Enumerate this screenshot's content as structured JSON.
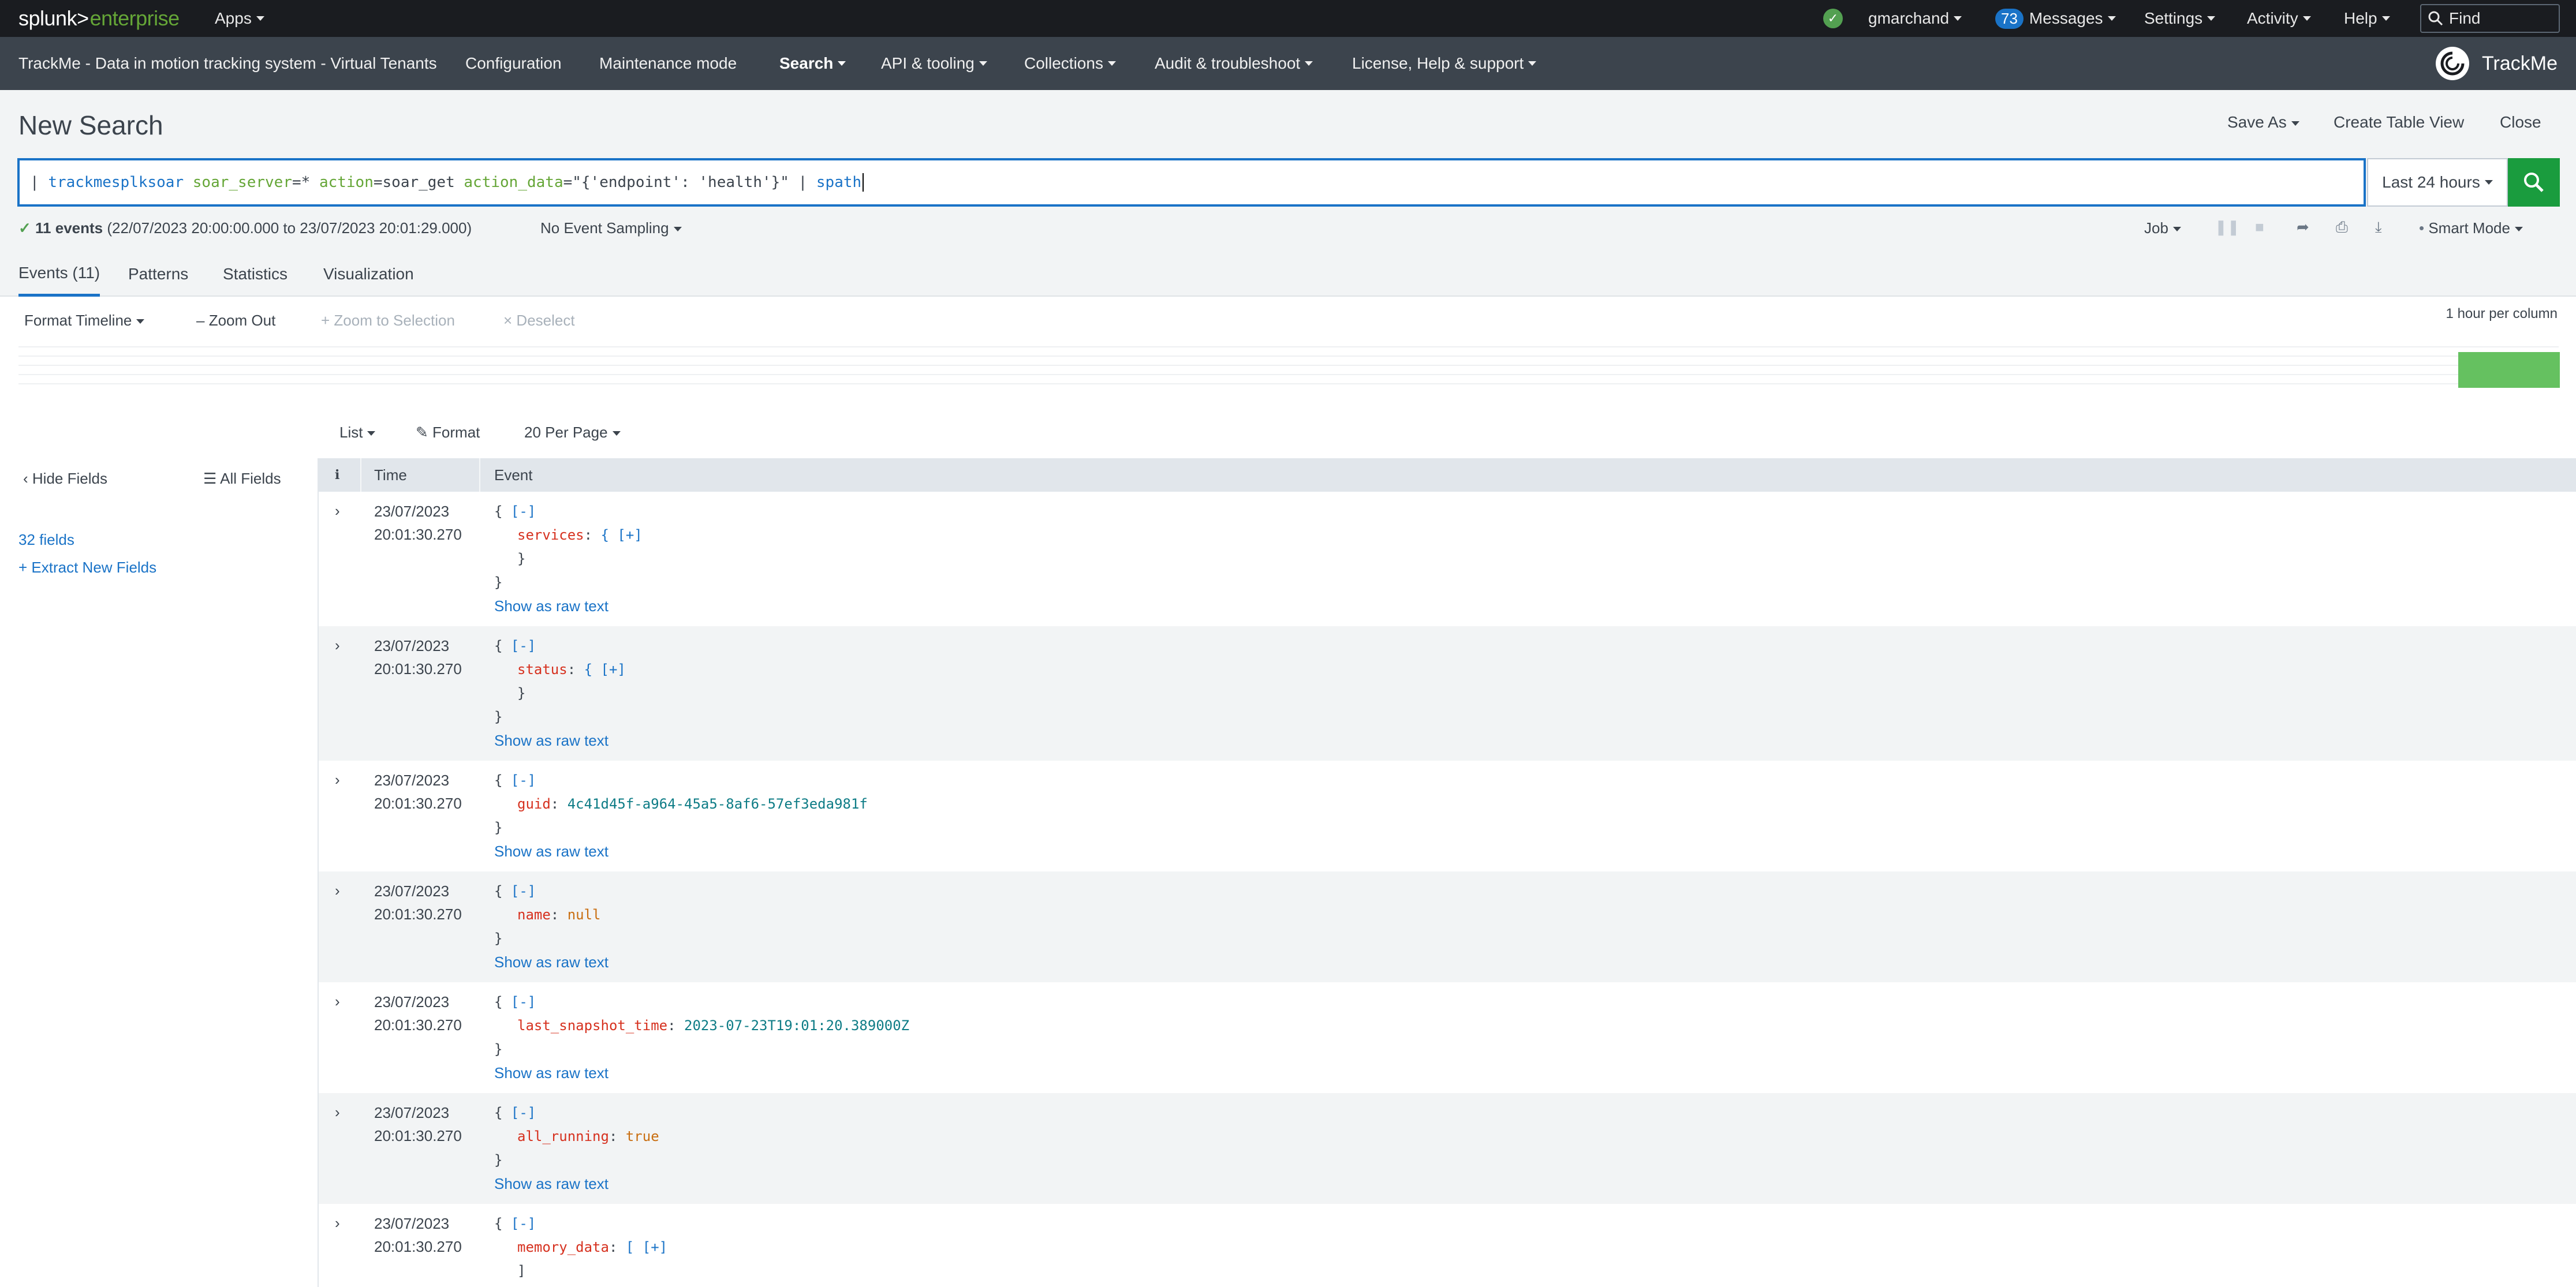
{
  "topbar": {
    "logo_left": "splunk>",
    "logo_right": "enterprise",
    "apps": "Apps",
    "user": "gmarchand",
    "messages_count": "73",
    "messages": "Messages",
    "settings": "Settings",
    "activity": "Activity",
    "help": "Help",
    "find_placeholder": "Find"
  },
  "appbar": {
    "app_title": "TrackMe - Data in motion tracking system - Virtual Tenants",
    "items": [
      "Configuration",
      "Maintenance mode",
      "Search",
      "API & tooling",
      "Collections",
      "Audit & troubleshoot",
      "License, Help & support"
    ],
    "logo_text": "TrackMe"
  },
  "page": {
    "title": "New Search",
    "save_as": "Save As",
    "create_table_view": "Create Table View",
    "close": "Close"
  },
  "search": {
    "query_parts": {
      "pipe1": "| ",
      "cmd1": "trackmesplksoar",
      "arg1": "soar_server",
      "eq1": "=* ",
      "arg2": "action",
      "eq2": "=soar_get ",
      "arg3": "action_data",
      "eq3": "=\"{'endpoint': 'health'}\" | ",
      "cmd2": "spath"
    },
    "time_range": "Last 24 hours"
  },
  "status": {
    "count": "11 events",
    "range": "(22/07/2023 20:00:00.000 to 23/07/2023 20:01:29.000)",
    "sampling": "No Event Sampling",
    "job": "Job",
    "mode": "Smart Mode"
  },
  "tabs": [
    "Events (11)",
    "Patterns",
    "Statistics",
    "Visualization"
  ],
  "timeline": {
    "format": "Format Timeline",
    "zoom_out": "Zoom Out",
    "zoom_selection": "Zoom to Selection",
    "deselect": "Deselect",
    "scale": "1 hour per column"
  },
  "results": {
    "list": "List",
    "format": "Format",
    "per_page": "20 Per Page"
  },
  "sidebar": {
    "hide_fields": "Hide Fields",
    "all_fields": "All Fields",
    "field_count": "32 fields",
    "extract": "Extract New Fields"
  },
  "table": {
    "col_info": "i",
    "col_time": "Time",
    "col_event": "Event",
    "raw_link": "Show as raw text",
    "rows": [
      {
        "date": "23/07/2023",
        "time": "20:01:30.270",
        "key": "services",
        "value": "{ [+]",
        "kind": "nested",
        "close": "}"
      },
      {
        "date": "23/07/2023",
        "time": "20:01:30.270",
        "key": "status",
        "value": "{ [+]",
        "kind": "nested",
        "close": "}"
      },
      {
        "date": "23/07/2023",
        "time": "20:01:30.270",
        "key": "guid",
        "value": "4c41d45f-a964-45a5-8af6-57ef3eda981f",
        "kind": "str"
      },
      {
        "date": "23/07/2023",
        "time": "20:01:30.270",
        "key": "name",
        "value": "null",
        "kind": "lit"
      },
      {
        "date": "23/07/2023",
        "time": "20:01:30.270",
        "key": "last_snapshot_time",
        "value": "2023-07-23T19:01:20.389000Z",
        "kind": "str"
      },
      {
        "date": "23/07/2023",
        "time": "20:01:30.270",
        "key": "all_running",
        "value": "true",
        "kind": "lit"
      },
      {
        "date": "23/07/2023",
        "time": "20:01:30.270",
        "key": "memory_data",
        "value": "[ [+]",
        "kind": "nested",
        "close": "]"
      }
    ]
  },
  "colors": {
    "accent": "#1a73c7",
    "brand_green": "#65a637",
    "search_button": "#1a9c3e",
    "appbar": "#3c444d"
  }
}
